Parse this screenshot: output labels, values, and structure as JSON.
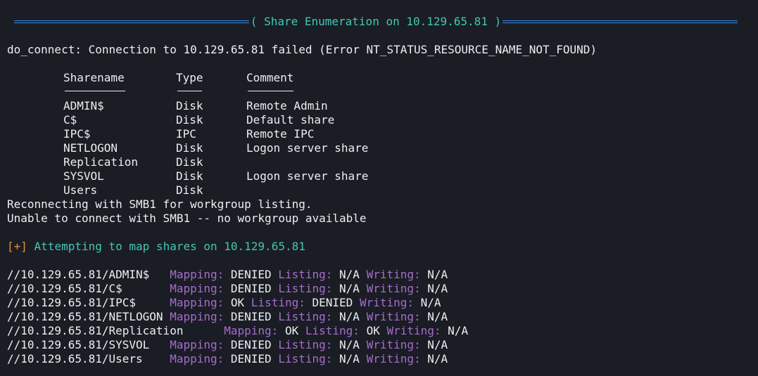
{
  "banner": {
    "title": "( Share Enumeration on 10.129.65.81 )"
  },
  "connect_error": "do_connect: Connection to 10.129.65.81 failed (Error NT_STATUS_RESOURCE_NAME_NOT_FOUND)",
  "share_table": {
    "headers": {
      "sharename": "Sharename",
      "type": "Type",
      "comment": "Comment"
    },
    "rows": [
      {
        "name": "ADMIN$",
        "type": "Disk",
        "comment": "Remote Admin"
      },
      {
        "name": "C$",
        "type": "Disk",
        "comment": "Default share"
      },
      {
        "name": "IPC$",
        "type": "IPC",
        "comment": "Remote IPC"
      },
      {
        "name": "NETLOGON",
        "type": "Disk",
        "comment": "Logon server share"
      },
      {
        "name": "Replication",
        "type": "Disk",
        "comment": ""
      },
      {
        "name": "SYSVOL",
        "type": "Disk",
        "comment": "Logon server share"
      },
      {
        "name": "Users",
        "type": "Disk",
        "comment": ""
      }
    ]
  },
  "smb1_lines": [
    "Reconnecting with SMB1 for workgroup listing.",
    "Unable to connect with SMB1 -- no workgroup available"
  ],
  "mapping_intro": {
    "marker": "[+]",
    "text": " Attempting to map shares on 10.129.65.81"
  },
  "mapping_labels": {
    "mapping": "Mapping:",
    "listing": "Listing:",
    "writing": "Writing:"
  },
  "mapping_rows": [
    {
      "path": "//10.129.65.81/ADMIN$",
      "mapping": "DENIED",
      "listing": "N/A",
      "writing": "N/A"
    },
    {
      "path": "//10.129.65.81/C$",
      "mapping": "DENIED",
      "listing": "N/A",
      "writing": "N/A"
    },
    {
      "path": "//10.129.65.81/IPC$",
      "mapping": "OK",
      "listing": "DENIED",
      "writing": "N/A"
    },
    {
      "path": "//10.129.65.81/NETLOGON",
      "mapping": "DENIED",
      "listing": "N/A",
      "writing": "N/A"
    },
    {
      "path": "//10.129.65.81/Replication",
      "mapping": "OK",
      "listing": "OK",
      "writing": "N/A"
    },
    {
      "path": "//10.129.65.81/SYSVOL",
      "mapping": "DENIED",
      "listing": "N/A",
      "writing": "N/A"
    },
    {
      "path": "//10.129.65.81/Users",
      "mapping": "DENIED",
      "listing": "N/A",
      "writing": "N/A"
    }
  ],
  "colors": {
    "background": "#1a1d24",
    "text": "#eceff1",
    "rule": "#3d8be6",
    "teal": "#45c6b3",
    "orange": "#e38f3a",
    "purple": "#a66ccf"
  }
}
